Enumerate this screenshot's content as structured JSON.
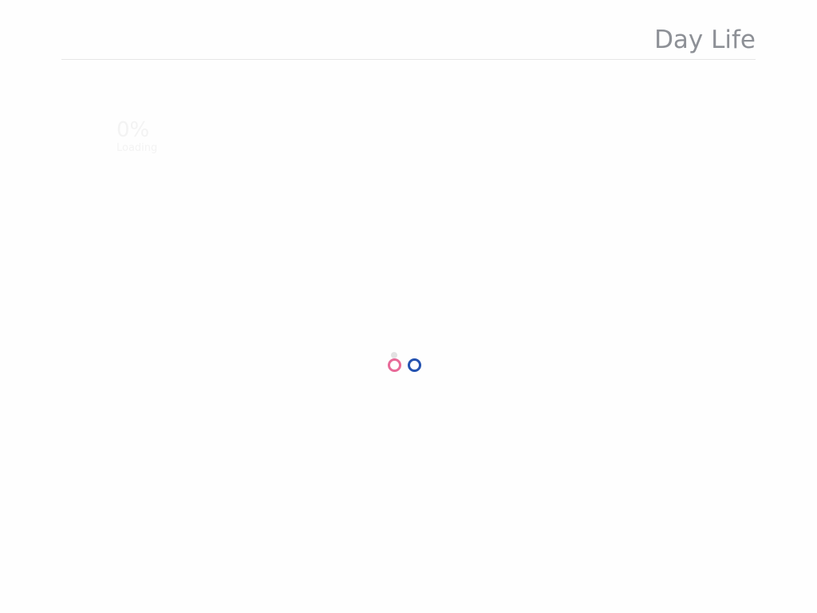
{
  "header": {
    "site_title": "Day Life"
  },
  "preloader": {
    "percent": "0%",
    "label": "Loading",
    "progress_fraction": 0
  },
  "loader": {
    "icon_top": "grey-dot",
    "icon_left": "pink-ring",
    "icon_right": "blue-ring",
    "colors": {
      "dot": "#e2e2e2",
      "pink": "#e86a98",
      "blue": "#2452b0"
    }
  }
}
